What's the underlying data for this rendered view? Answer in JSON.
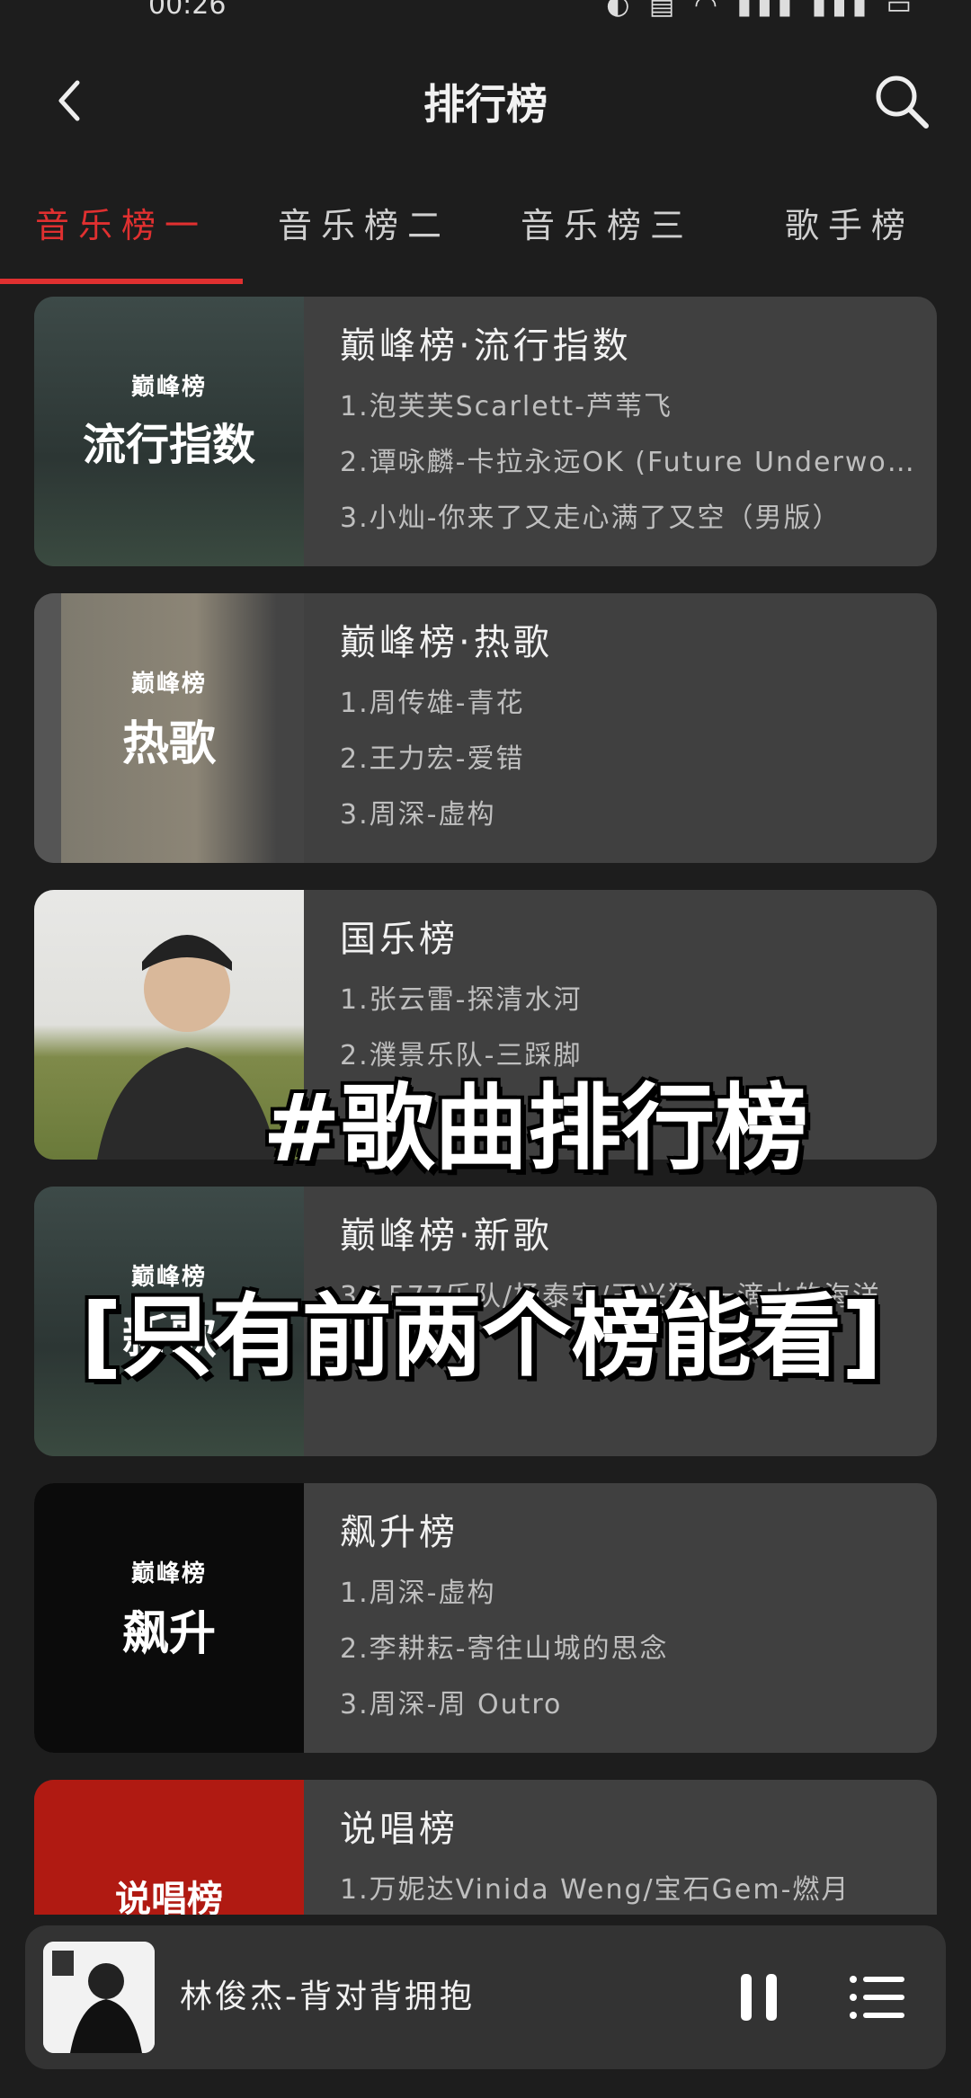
{
  "status": {
    "time": "00:26"
  },
  "header": {
    "title": "排行榜"
  },
  "tabs": [
    {
      "label": "音乐榜一"
    },
    {
      "label": "音乐榜二"
    },
    {
      "label": "音乐榜三"
    },
    {
      "label": "歌手榜"
    }
  ],
  "cover_logo": "巅峰榜",
  "charts": [
    {
      "title": "巅峰榜·流行指数",
      "cover_label": "流行指数",
      "songs": [
        "1.泡芙芙Scarlett-芦苇飞",
        "2.谭咏麟-卡拉永远OK (Future Underworld ...",
        "3.小灿-你来了又走心满了又空（男版）"
      ]
    },
    {
      "title": "巅峰榜·热歌",
      "cover_label": "热歌",
      "songs": [
        "1.周传雄-青花",
        "2.王力宏-爱错",
        "3.周深-虚构"
      ]
    },
    {
      "title": "国乐榜",
      "cover_label": "",
      "songs": [
        "1.张云雷-探清水河",
        "2.濮景乐队-三踩脚",
        ""
      ]
    },
    {
      "title": "巅峰榜·新歌",
      "cover_label": "新歌",
      "songs": [
        "",
        "",
        "3.1577乐队/杨泰安/王兴猛-一滴水的海洋"
      ]
    },
    {
      "title": "飙升榜",
      "cover_label": "飙升",
      "songs": [
        "1.周深-虚构",
        "2.李耕耘-寄往山城的思念",
        "3.周深-周 Outro"
      ]
    },
    {
      "title": "说唱榜",
      "cover_label": "说唱榜",
      "songs": [
        "1.万妮达Vinida Weng/宝石Gem-燃月"
      ]
    }
  ],
  "overlays": {
    "line1": "#歌曲排行榜",
    "line2": "[只有前两个榜能看]"
  },
  "player": {
    "now_playing": "林俊杰-背对背拥抱"
  },
  "colors": {
    "accent": "#e03030",
    "background": "#1d1d1d",
    "card": "#404040"
  }
}
